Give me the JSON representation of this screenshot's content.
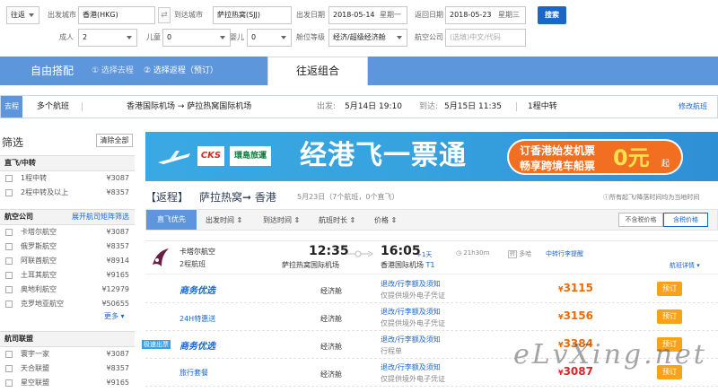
{
  "search": {
    "trip_type": "往返",
    "from_label": "出发城市",
    "from_value": "香港(HKG)",
    "to_label": "到达城市",
    "to_value": "萨拉热窝(SJJ)",
    "depart_label": "出发日期",
    "depart_date": "2018-05-14",
    "depart_weekday": "星期一",
    "return_label": "返回日期",
    "return_date": "2018-05-23",
    "return_weekday": "星期三",
    "search_button": "搜索",
    "adult_label": "成人",
    "adult_value": "2",
    "child_label": "儿童",
    "child_value": "0",
    "infant_label": "婴儿",
    "infant_value": "0",
    "cabin_label": "舱位等级",
    "cabin_value": "经济/超级经济舱",
    "airline_label": "航空公司",
    "airline_placeholder": "(选填)中文/代码"
  },
  "tabs": {
    "free_combo": "自由搭配",
    "step1": "① 选择去程",
    "step2": "② 选择返程（预订）",
    "round_combo": "往返组合"
  },
  "route": {
    "tag": "去程",
    "flights": "多个航班",
    "route_text": "香港国际机场 → 萨拉热窝国际机场",
    "depart_label": "出发:",
    "depart_time": "5月14日 19:10",
    "arrive_label": "到达:",
    "arrive_time": "5月15日 11:35",
    "stops": "1程中转",
    "modify": "修改航班"
  },
  "filter": {
    "title": "筛选",
    "clear": "清除全部",
    "sections": {
      "direct": "直飞/中转",
      "airline": "航空公司",
      "alliance": "航司联盟"
    },
    "direct_items": [
      {
        "label": "1程中转",
        "price": "¥3087"
      },
      {
        "label": "2程中转及以上",
        "price": "¥8357"
      }
    ],
    "expand_airlines": "展开航司矩阵筛选",
    "airline_items": [
      {
        "label": "卡塔尔航空",
        "price": "¥3087"
      },
      {
        "label": "俄罗斯航空",
        "price": "¥8357"
      },
      {
        "label": "阿联酋航空",
        "price": "¥8914"
      },
      {
        "label": "土耳其航空",
        "price": "¥9165"
      },
      {
        "label": "奥地利航空",
        "price": "¥12979"
      },
      {
        "label": "克罗地亚航空",
        "price": "¥50655"
      }
    ],
    "more": "更多",
    "alliance_items": [
      {
        "label": "寰宇一家",
        "price": "¥3087"
      },
      {
        "label": "天合联盟",
        "price": "¥8357"
      },
      {
        "label": "星空联盟",
        "price": "¥9165"
      }
    ]
  },
  "banner": {
    "logo1": "CKS",
    "logo2": "環島旅運",
    "headline": "经港飞一票通",
    "promo_line1": "订香港始发机票",
    "promo_line2": "畅享跨境车船票",
    "promo_price": "0元",
    "promo_suffix": "起"
  },
  "return_header": {
    "tag": "【返程】",
    "route": "萨拉热窝➞ 香港",
    "date_info": "5月23日（7个航班，0个直飞）",
    "timezone_note": "所有起飞/降落时间均为当地时间"
  },
  "sortbar": {
    "direct_first": "直飞优先",
    "depart_time": "出发时间",
    "arrive_time": "到达时间",
    "duration": "航班时长",
    "price": "价格",
    "tax_excl": "不含税价格",
    "tax_incl": "含税价格"
  },
  "flight": {
    "airline": "卡塔尔航空",
    "flights_count": "2程航班",
    "dep_time": "12:35",
    "dep_airport": "萨拉热窝国际机场",
    "arr_time": "16:05",
    "arr_plus": "+1天",
    "arr_airport": "香港国际机场",
    "arr_terminal": "T1",
    "duration": "21h30m",
    "stop_city": "多哈",
    "transfer_note": "中转行李提醒",
    "details": "航班详情"
  },
  "fares": [
    {
      "name": "商务优选",
      "cabin": "经济舱",
      "rules": "退改/行李额及须知",
      "note": "仅提供境外电子凭证",
      "price": "3115",
      "book": "预订",
      "badge": ""
    },
    {
      "name": "24H特惠送",
      "cabin": "经济舱",
      "rules": "退改/行李额及须知",
      "note": "仅提供境外电子凭证",
      "price": "3156",
      "book": "预订",
      "badge": ""
    },
    {
      "name": "商务优选",
      "cabin": "经济舱",
      "rules": "退改/行李额及须知",
      "note": "行程单",
      "price": "3384",
      "book": "预订",
      "badge": "极速出票"
    },
    {
      "name": "旅行套餐",
      "cabin": "经济舱",
      "rules": "退改/行李额及须知",
      "note": "仅提供境外电子凭证",
      "price": "3087",
      "book": "预订",
      "badge": ""
    }
  ],
  "watermark": "eLvXing.net",
  "colors": {
    "primary": "#1a66c9",
    "tab_bar": "#5d96db",
    "price": "#f06a00",
    "book": "#f7a21b",
    "banner": "#36a3df"
  }
}
